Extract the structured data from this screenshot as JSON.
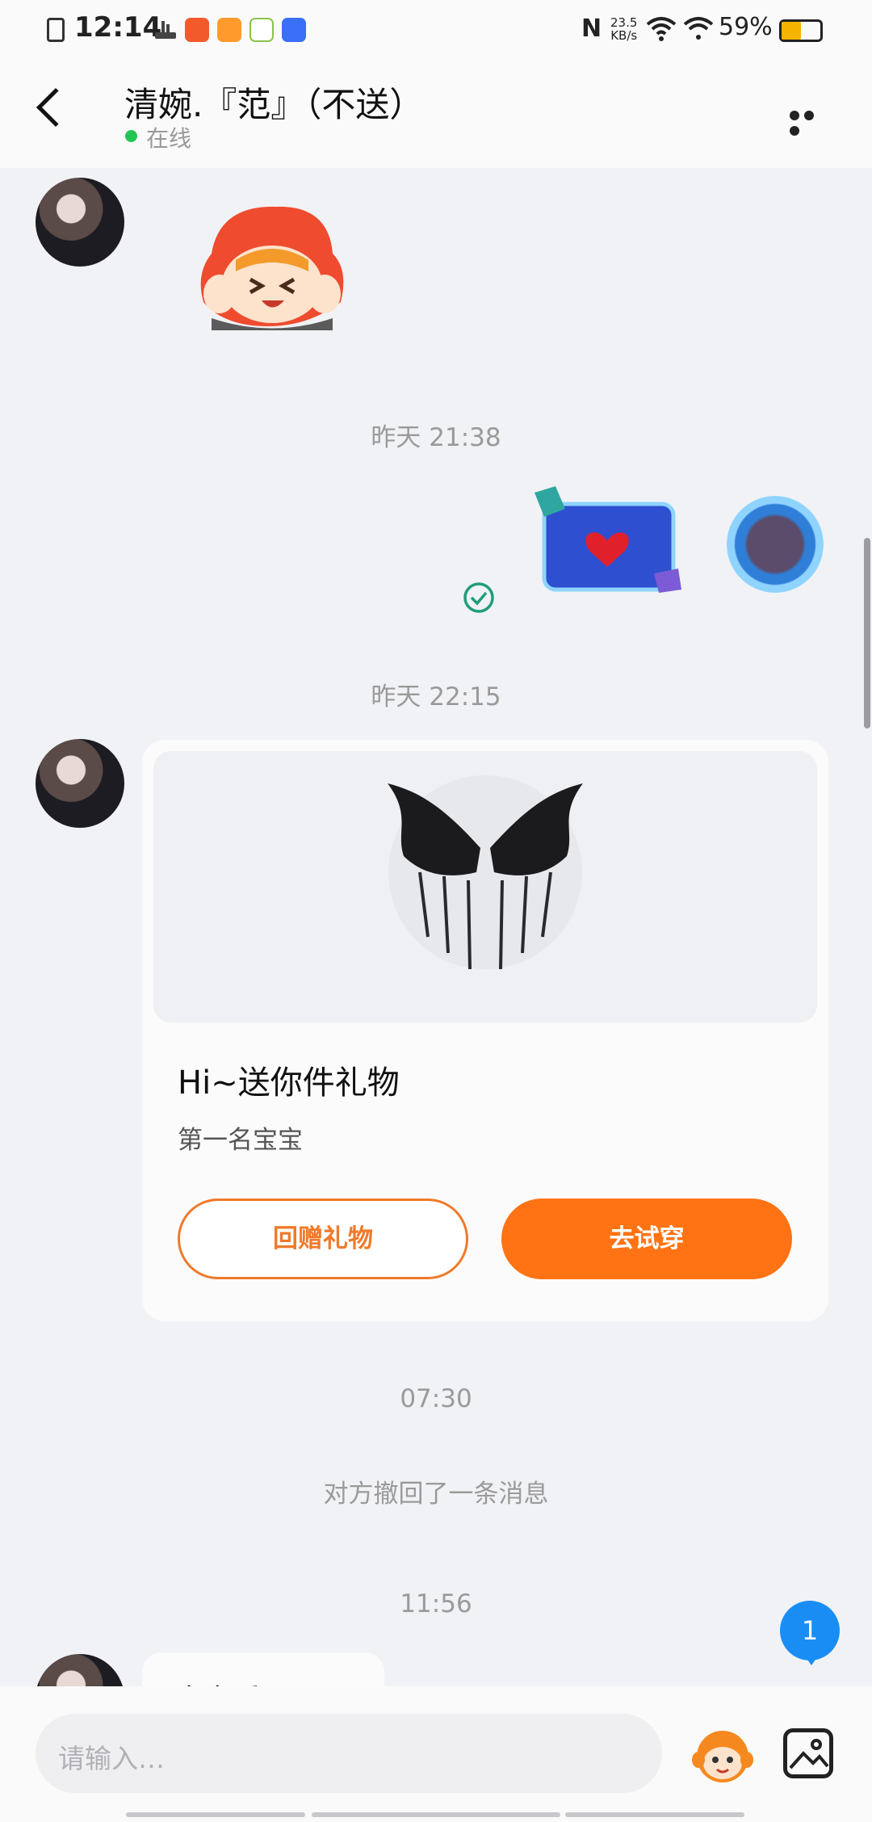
{
  "status_bar": {
    "time": "12:14",
    "net_speed_value": "23.5",
    "net_speed_unit": "KB/s",
    "battery": "59%"
  },
  "header": {
    "title": "清婉.『范』（不送）",
    "status": "在线"
  },
  "messages": {
    "ts1": "昨天 21:38",
    "ts2": "昨天 22:15",
    "ts3": "07:30",
    "ts4": "11:56",
    "recall": "对方撤回了一条消息",
    "partial": "水宝看一下"
  },
  "gift_card": {
    "title": "Hi~送你件礼物",
    "subtitle": "第一名宝宝",
    "return_gift": "回赠礼物",
    "try_on": "去试穿"
  },
  "input": {
    "placeholder": "请输入…"
  },
  "badge": {
    "count": "1"
  },
  "colors": {
    "accent": "#ff7314",
    "online": "#23c552",
    "badge": "#1a8df5",
    "check": "#1f9e7a"
  }
}
